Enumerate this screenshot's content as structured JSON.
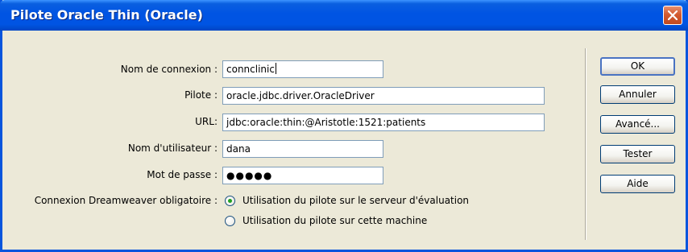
{
  "window": {
    "title": "Pilote Oracle Thin (Oracle)"
  },
  "form": {
    "connection_name_label": "Nom de connexion :",
    "connection_name_value": "connclinic",
    "driver_label": "Pilote :",
    "driver_value": "oracle.jdbc.driver.OracleDriver",
    "url_label": "URL:",
    "url_value": "jdbc:oracle:thin:@Aristotle:1521:patients",
    "username_label": "Nom d'utilisateur :",
    "username_value": "dana",
    "password_label": "Mot de passe :",
    "password_value": "●●●●●",
    "dw_connection_label": "Connexion Dreamweaver obligatoire :",
    "radio_options": [
      {
        "label": "Utilisation du pilote sur le serveur d'évaluation",
        "selected": true
      },
      {
        "label": "Utilisation du pilote sur cette machine",
        "selected": false
      }
    ]
  },
  "buttons": {
    "ok": "OK",
    "cancel": "Annuler",
    "advanced": "Avancé...",
    "test": "Tester",
    "help": "Aide"
  },
  "icons": {
    "close": "close-icon",
    "radio_selected": "radio-selected-icon",
    "radio_unselected": "radio-unselected-icon"
  },
  "colors": {
    "titlebar": "#0054e3",
    "dialog_background": "#ece9d8",
    "close_button": "#d35b30",
    "field_border": "#7f9db9",
    "radio_dot": "#21a121"
  }
}
